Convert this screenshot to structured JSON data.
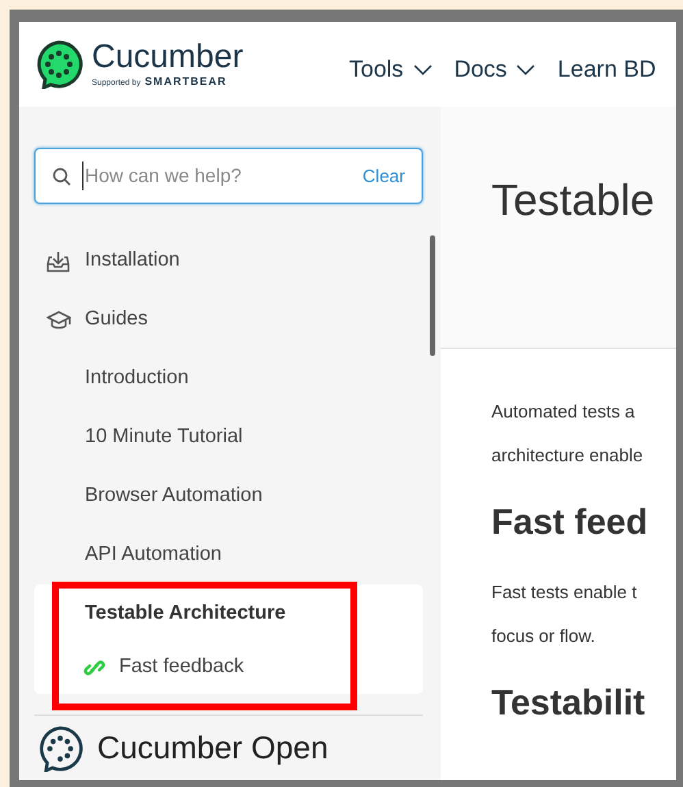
{
  "header": {
    "logo": {
      "name": "Cucumber",
      "tagline": "Supported by",
      "sponsor": "SMARTBEAR"
    },
    "nav": [
      {
        "label": "Tools",
        "dropdown": true
      },
      {
        "label": "Docs",
        "dropdown": true
      },
      {
        "label": "Learn BD",
        "dropdown": false
      }
    ]
  },
  "search": {
    "placeholder": "How can we help?",
    "clear": "Clear"
  },
  "sidebar": {
    "items": [
      {
        "label": "Installation",
        "kind": "download",
        "selected": false
      },
      {
        "label": "Guides",
        "kind": "cap",
        "selected": false,
        "children": [
          {
            "label": "Introduction",
            "selected": false
          },
          {
            "label": "10 Minute Tutorial",
            "selected": false
          },
          {
            "label": "Browser Automation",
            "selected": false
          },
          {
            "label": "API Automation",
            "selected": false
          },
          {
            "label": "Testable Architecture",
            "selected": true,
            "children": [
              {
                "label": "Fast feedback",
                "kind": "link",
                "selected": false
              }
            ]
          }
        ]
      }
    ],
    "footer": "Cucumber Open"
  },
  "content": {
    "title": "Testable",
    "blocks": [
      {
        "kind": "paragraph",
        "lines": [
          "Automated tests a",
          "architecture enable"
        ]
      },
      {
        "kind": "heading",
        "text": "Fast feed"
      },
      {
        "kind": "paragraph",
        "lines": [
          "Fast tests enable t",
          "focus or flow."
        ]
      },
      {
        "kind": "heading",
        "text": "Testabilit"
      }
    ]
  },
  "annotation": {
    "kind": "highlight"
  }
}
